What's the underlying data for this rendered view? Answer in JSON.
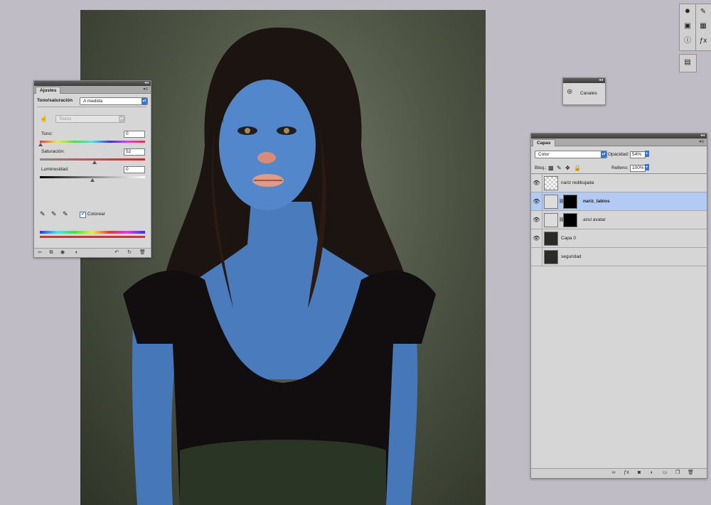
{
  "ajustes": {
    "tab": "Ajustes",
    "header_label": "Tono/saturación",
    "preset": "A medida",
    "channel": "Todos",
    "tono_label": "Tono:",
    "tono_value": "0",
    "saturacion_label": "Saturación:",
    "saturacion_value": "52",
    "luminosidad_label": "Luminosidad:",
    "luminosidad_value": "0",
    "colorear_label": "Colorear",
    "colorear_checked": true,
    "icons": [
      "return-icon",
      "clip-layer-icon",
      "visibility-icon",
      "view-previous-icon",
      "reset-icon",
      "refresh-icon",
      "trash-icon"
    ]
  },
  "canales": {
    "label": "Canales"
  },
  "capas": {
    "tab": "Capas",
    "blend_mode": "Color",
    "opacity_label": "Opacidad:",
    "opacity_value": "54%",
    "lock_label": "Bloq.:",
    "fill_label": "Relleno:",
    "fill_value": "100%",
    "layers": [
      {
        "name": "nariz redibujada",
        "visible": true,
        "selected": false
      },
      {
        "name": "nariz_labios",
        "visible": true,
        "selected": true
      },
      {
        "name": "azul avatar",
        "visible": true,
        "selected": false
      },
      {
        "name": "Capa 0",
        "visible": true,
        "selected": false
      },
      {
        "name": "seguridad",
        "visible": false,
        "selected": false
      }
    ],
    "footer_icons": [
      "link-icon",
      "fx-icon",
      "mask-icon",
      "adjustment-icon",
      "group-icon",
      "new-layer-icon",
      "trash-icon"
    ]
  },
  "colors": {
    "background": "#c0bcc5",
    "selected_layer": "#b3cbf4",
    "dropdown_accent": "#3b73d1",
    "skin_blue": "#4f7fc0"
  }
}
